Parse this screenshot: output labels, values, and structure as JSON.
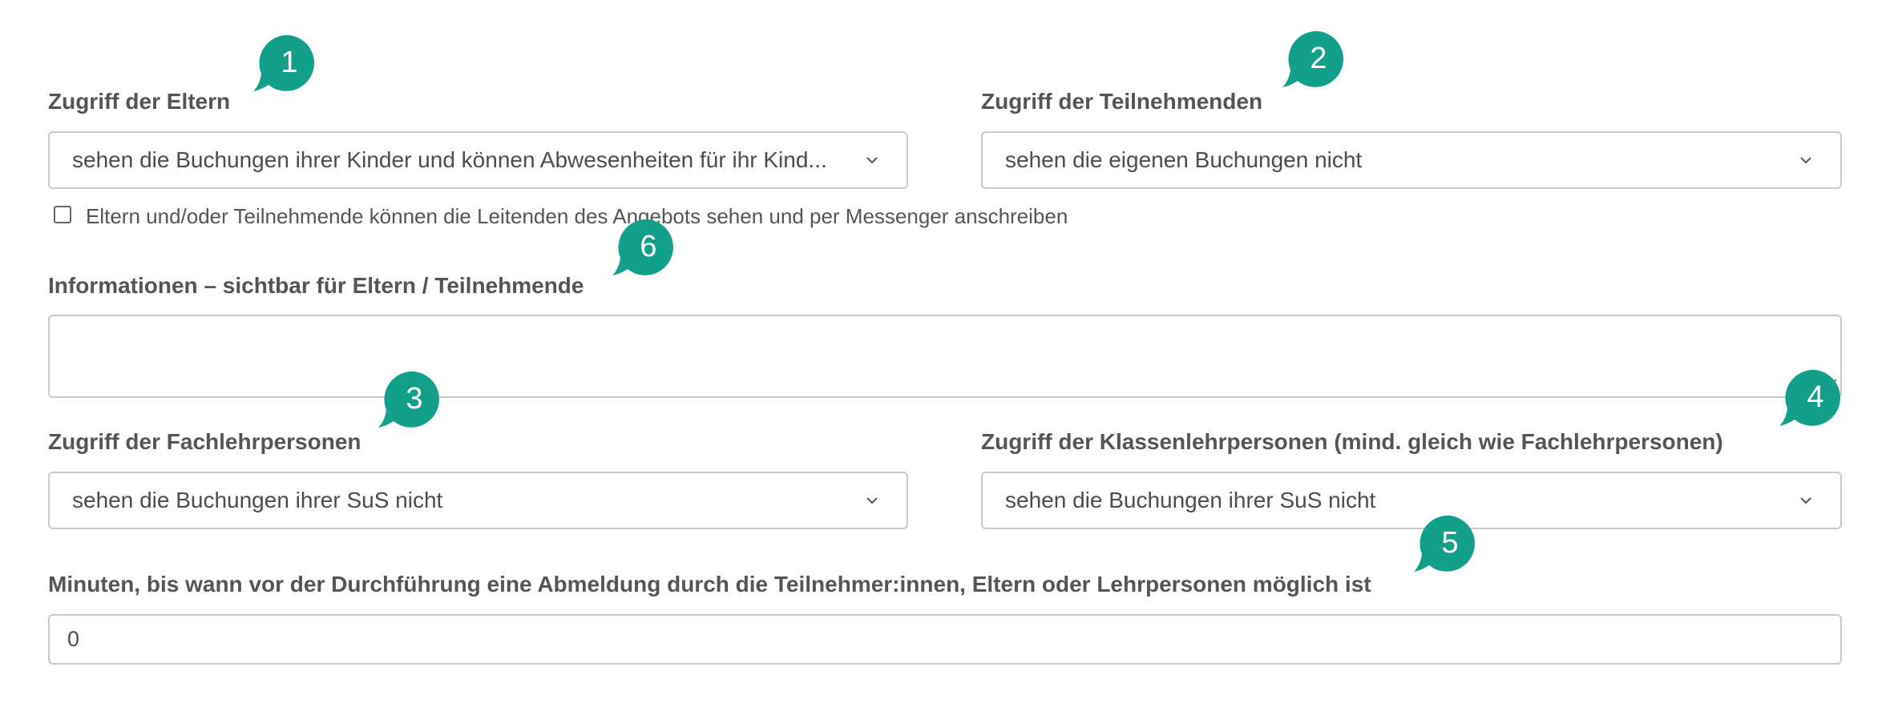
{
  "parents_access": {
    "label": "Zugriff der Eltern",
    "value": "sehen die Buchungen ihrer Kinder und können Abwesenheiten für ihr Kind..."
  },
  "participants_access": {
    "label": "Zugriff der Teilnehmenden",
    "value": "sehen die eigenen Buchungen nicht"
  },
  "leaders_checkbox": {
    "label": "Eltern und/oder Teilnehmende können die Leitenden des Angebots sehen und per Messenger anschreiben",
    "checked": false
  },
  "info": {
    "label": "Informationen – sichtbar für Eltern / Teilnehmende",
    "value": ""
  },
  "subject_teachers_access": {
    "label": "Zugriff der Fachlehrpersonen",
    "value": "sehen die Buchungen ihrer SuS nicht"
  },
  "class_teachers_access": {
    "label": "Zugriff der Klassenlehrpersonen (mind. gleich wie Fachlehrpersonen)",
    "value": "sehen die Buchungen ihrer SuS nicht"
  },
  "cancellation_minutes": {
    "label": "Minuten, bis wann vor der Durchführung eine Abmeldung durch die Teilnehmer:innen, Eltern oder Lehrpersonen möglich ist",
    "value": "0"
  },
  "badges": [
    "1",
    "2",
    "3",
    "4",
    "5",
    "6"
  ],
  "colors": {
    "badge": "#13a08a",
    "border": "#c9c9c9",
    "label": "#555555"
  },
  "icons": {
    "select_chevron": "chevron-down-icon",
    "textarea_resize": "resize-handle-icon"
  }
}
